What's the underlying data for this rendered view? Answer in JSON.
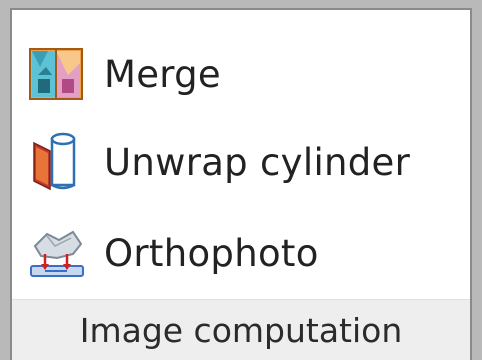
{
  "ribbon_group": {
    "caption": "Image computation",
    "commands": [
      {
        "label": "Merge",
        "icon": "merge-icon"
      },
      {
        "label": "Unwrap cylinder",
        "icon": "unwrap-cylinder-icon"
      },
      {
        "label": "Orthophoto",
        "icon": "orthophoto-icon"
      }
    ]
  }
}
